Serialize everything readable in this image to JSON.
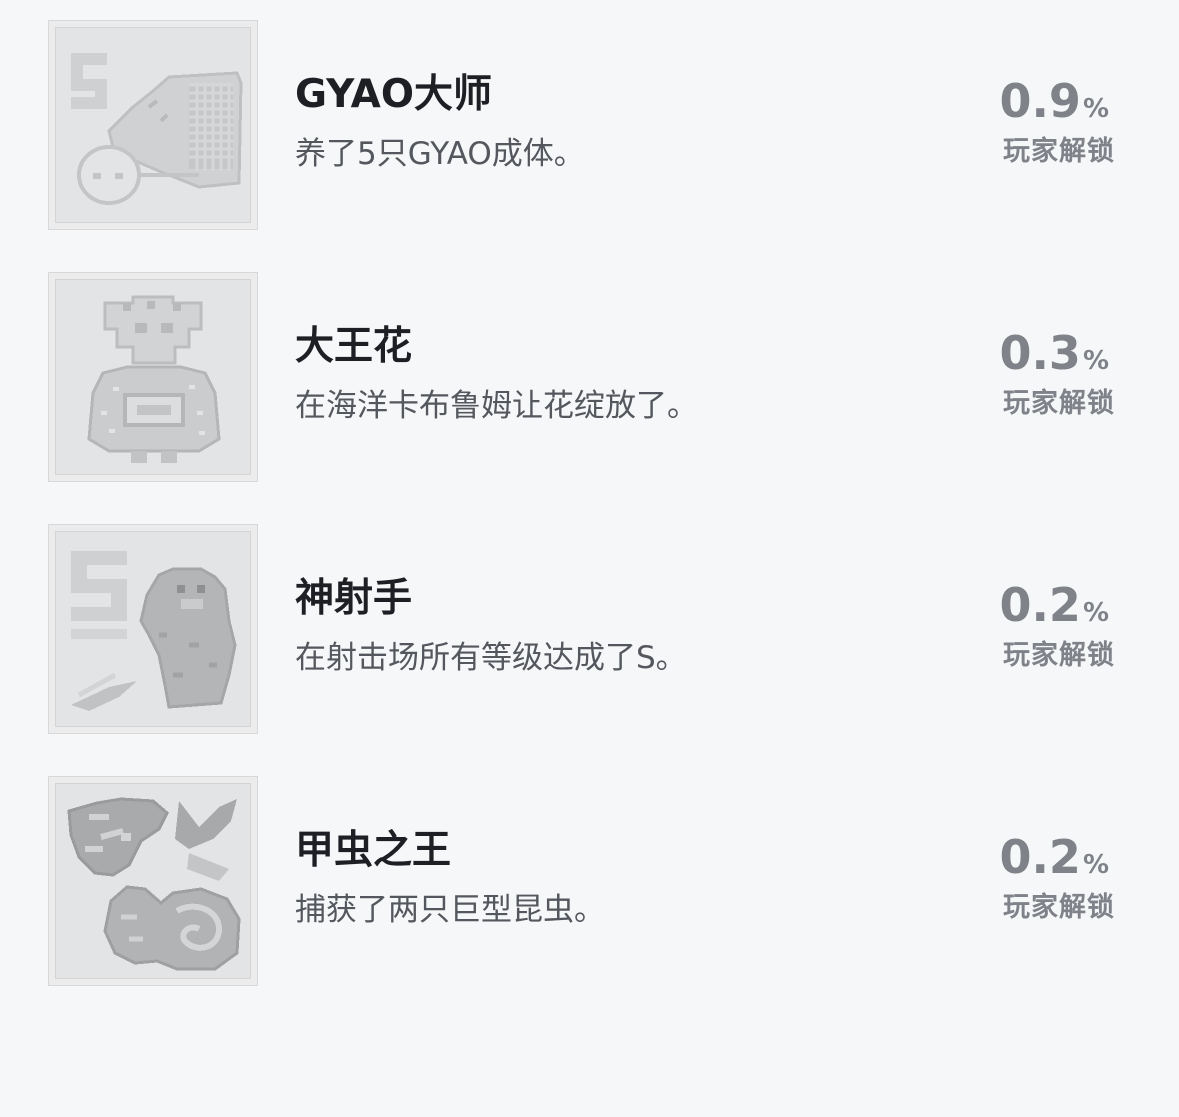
{
  "achievements": [
    {
      "icon": "gyao-master-icon",
      "title": "GYAO大师",
      "description": "养了5只GYAO成体。",
      "percent": "0.9",
      "percent_sign": "%",
      "unlock_label": "玩家解锁"
    },
    {
      "icon": "king-flower-icon",
      "title": "大王花",
      "description": "在海洋卡布鲁姆让花绽放了。",
      "percent": "0.3",
      "percent_sign": "%",
      "unlock_label": "玩家解锁"
    },
    {
      "icon": "sharpshooter-icon",
      "title": "神射手",
      "description": "在射击场所有等级达成了S。",
      "percent": "0.2",
      "percent_sign": "%",
      "unlock_label": "玩家解锁"
    },
    {
      "icon": "beetle-king-icon",
      "title": "甲虫之王",
      "description": "捕获了两只巨型昆虫。",
      "percent": "0.2",
      "percent_sign": "%",
      "unlock_label": "玩家解锁"
    }
  ]
}
